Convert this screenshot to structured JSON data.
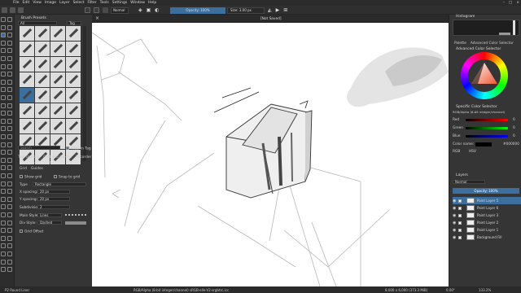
{
  "menu": [
    "File",
    "Edit",
    "View",
    "Image",
    "Layer",
    "Select",
    "Filter",
    "Tools",
    "Settings",
    "Window",
    "Help"
  ],
  "toolbar": {
    "blend_mode": "Normal",
    "opacity_label": "Opacity: 100%",
    "size_label": "Size: 3.00 px"
  },
  "document": {
    "tab_title": "[Not Saved]"
  },
  "brush_presets": {
    "title": "Brush Presets",
    "filter": "All",
    "tag_label": "Tag",
    "search_placeholder": "Search",
    "filter_in_tag": "Filter in Tag"
  },
  "left_tabs": [
    "Tool Options",
    "Grid and Guides",
    "Recorder"
  ],
  "grid": {
    "title": "Grid and Guides",
    "subtabs": [
      "Grid",
      "Guides"
    ],
    "show_grid": "Show grid",
    "snap_to_grid": "Snap to grid",
    "type_label": "Type",
    "type_value": "Rectangle",
    "x_spacing_label": "X spacing:",
    "x_spacing_value": "20 px",
    "y_spacing_label": "Y spacing:",
    "y_spacing_value": "20 px",
    "subdivision_label": "Subdivision:",
    "subdivision_value": "2",
    "main_style_label": "Main Style:",
    "main_style_value": "Lines",
    "div_style_label": "Div Style:",
    "div_style_value": "Dashed",
    "offset_label": "Grid Offset"
  },
  "right": {
    "histogram_title": "Histogram",
    "tabs": [
      "Palette",
      "Advanced Color Selector"
    ],
    "adv_title": "Advanced Color Selector",
    "specific_title": "Specific Color Selector",
    "color_space": "RGB/Alpha (8-bit integer/channel)",
    "red_label": "Red",
    "green_label": "Green",
    "blue_label": "Blue",
    "red_value": "0",
    "green_value": "0",
    "blue_value": "0",
    "color_name_label": "Color name:",
    "color_name_value": "#000000",
    "rgb_label": "RGB",
    "hsv_label": "HSV"
  },
  "layers": {
    "title": "Layers",
    "blend": "Normal",
    "opacity": "Opacity: 100%",
    "items": [
      "Paint Layer 5",
      "Paint Layer 6",
      "Paint Layer 3",
      "Paint Layer 2",
      "Paint Layer 1",
      "Background Fill"
    ]
  },
  "status": {
    "brush": "P2 Round Liner",
    "colorspace": "RGB/Alpha (8-bit integer/channel)  sRGB-elle-V2-srgbtrc.icc",
    "dims": "8,000 x 6,000 (373.3 MiB)",
    "zoom": "133.2%",
    "angle": "0.00°"
  },
  "colors": {
    "accent": "#3d6f9e",
    "panel": "#353535",
    "canvas": "#ffffff"
  }
}
